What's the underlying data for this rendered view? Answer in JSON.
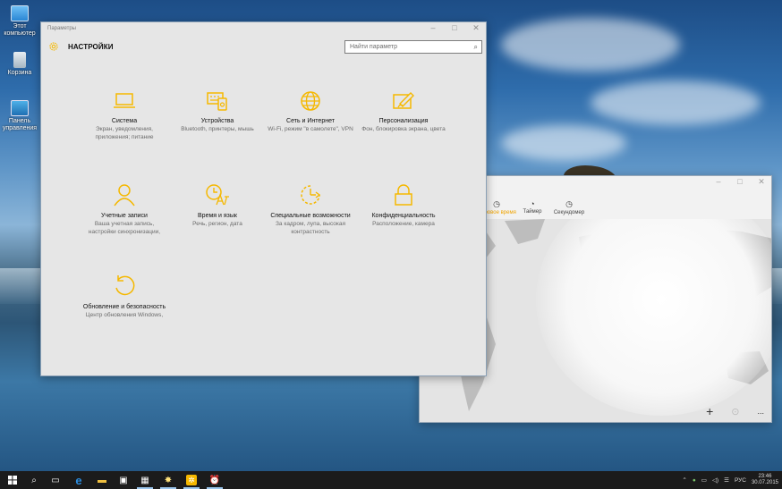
{
  "desktop": {
    "icons": [
      {
        "label": "Этот компьютер",
        "icon": "computer-icon"
      },
      {
        "label": "Корзина",
        "icon": "recycle-bin-icon"
      },
      {
        "label": "Панель управления",
        "icon": "control-panel-icon"
      }
    ]
  },
  "settings": {
    "window_title": "Параметры",
    "header": "НАСТРОЙКИ",
    "search_placeholder": "Найти параметр",
    "accent": "#f5b800",
    "tiles": [
      {
        "title": "Система",
        "desc": "Экран, уведомления, приложения; питание",
        "icon": "laptop-icon"
      },
      {
        "title": "Устройства",
        "desc": "Bluetooth, принтеры, мышь",
        "icon": "devices-icon"
      },
      {
        "title": "Сеть и Интернет",
        "desc": "Wi-Fi, режим \"в самолете\", VPN",
        "icon": "globe-icon"
      },
      {
        "title": "Персонализация",
        "desc": "Фон, блокировка экрана, цвета",
        "icon": "personalization-icon"
      },
      {
        "title": "Учетные записи",
        "desc": "Ваша учетная запись, настройки синхронизации,",
        "icon": "person-icon"
      },
      {
        "title": "Время и язык",
        "desc": "Речь, регион, дата",
        "icon": "time-language-icon"
      },
      {
        "title": "Специальные возможности",
        "desc": "За кадром, лупа, высокая контрастность",
        "icon": "accessibility-icon"
      },
      {
        "title": "Конфиденциальность",
        "desc": "Расположение, камера",
        "icon": "lock-icon"
      },
      {
        "title": "Обновление и безопасность",
        "desc": "Центр обновления Windows,",
        "icon": "update-icon"
      }
    ]
  },
  "clock_app": {
    "tabs": [
      {
        "label": "Мировое время",
        "icon": "globe-clock-icon"
      },
      {
        "label": "Таймер",
        "icon": "timer-icon"
      },
      {
        "label": "Секундомер",
        "icon": "stopwatch-icon"
      }
    ],
    "add_label": "+",
    "more_label": "..."
  },
  "taskbar": {
    "language": "РУС",
    "time": "23:46",
    "date": "30.07.2015"
  }
}
